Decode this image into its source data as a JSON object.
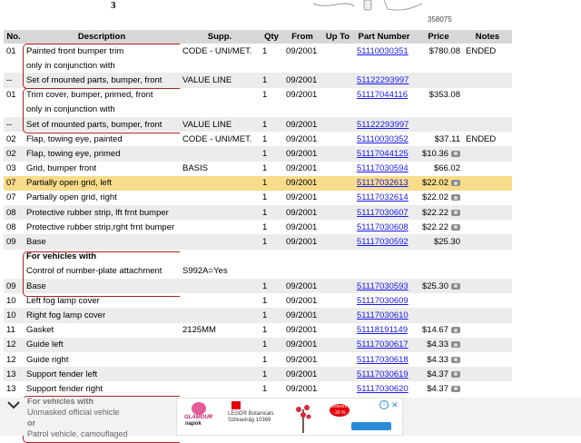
{
  "header": {
    "step_number": "3",
    "diagram_id": "358075"
  },
  "table": {
    "columns": [
      "No.",
      "Description",
      "Supp.",
      "Qty",
      "From",
      "Up To",
      "Part Number",
      "Price",
      "Notes"
    ],
    "rows": [
      {
        "no": "01",
        "desc": "Painted front bumper trim",
        "supp": "CODE - UNI/MET.",
        "qty": "1",
        "from": "09/2001",
        "upto": "",
        "pn": "51110030351",
        "price": "$780.08",
        "notes": "ENDED",
        "style": "",
        "cam": false
      },
      {
        "no": "",
        "desc": "only in conjunction with",
        "supp": "",
        "qty": "",
        "from": "",
        "upto": "",
        "pn": "",
        "price": "",
        "notes": "",
        "style": "",
        "cam": false
      },
      {
        "no": "--",
        "desc": "Set of mounted parts, bumper, front",
        "supp": "VALUE LINE",
        "qty": "1",
        "from": "09/2001",
        "upto": "",
        "pn": "51122293997",
        "price": "",
        "notes": "",
        "style": "alt",
        "cam": false
      },
      {
        "no": "01",
        "desc": "Trim cover, bumper, primed, front",
        "supp": "",
        "qty": "1",
        "from": "09/2001",
        "upto": "",
        "pn": "51117044116",
        "price": "$353.08",
        "notes": "",
        "style": "",
        "cam": false
      },
      {
        "no": "",
        "desc": "only in conjunction with",
        "supp": "",
        "qty": "",
        "from": "",
        "upto": "",
        "pn": "",
        "price": "",
        "notes": "",
        "style": "",
        "cam": false
      },
      {
        "no": "--",
        "desc": "Set of mounted parts, bumper, front",
        "supp": "VALUE LINE",
        "qty": "1",
        "from": "09/2001",
        "upto": "",
        "pn": "51122293997",
        "price": "",
        "notes": "",
        "style": "alt",
        "cam": false
      },
      {
        "no": "02",
        "desc": "Flap, towing eye, painted",
        "supp": "CODE - UNI/MET.",
        "qty": "1",
        "from": "09/2001",
        "upto": "",
        "pn": "51110030352",
        "price": "$37.11",
        "notes": "ENDED",
        "style": "",
        "cam": false
      },
      {
        "no": "02",
        "desc": "Flap, towing eye, primed",
        "supp": "",
        "qty": "1",
        "from": "09/2001",
        "upto": "",
        "pn": "51117044125",
        "price": "$10.36",
        "notes": "",
        "style": "alt",
        "cam": true
      },
      {
        "no": "03",
        "desc": "Grid, bumper front",
        "supp": "BASIS",
        "qty": "1",
        "from": "09/2001",
        "upto": "",
        "pn": "51117030594",
        "price": "$66.02",
        "notes": "",
        "style": "",
        "cam": false
      },
      {
        "no": "07",
        "desc": "Partially open grid, left",
        "supp": "",
        "qty": "1",
        "from": "09/2001",
        "upto": "",
        "pn": "51117032613",
        "price": "$22.02",
        "notes": "",
        "style": "hl",
        "cam": true
      },
      {
        "no": "07",
        "desc": "Partially open grid, right",
        "supp": "",
        "qty": "1",
        "from": "09/2001",
        "upto": "",
        "pn": "51117032614",
        "price": "$22.02",
        "notes": "",
        "style": "",
        "cam": true
      },
      {
        "no": "08",
        "desc": "Protective rubber strip, lft frnt bumper",
        "supp": "",
        "qty": "1",
        "from": "09/2001",
        "upto": "",
        "pn": "51117030607",
        "price": "$22.22",
        "notes": "",
        "style": "alt",
        "cam": true
      },
      {
        "no": "08",
        "desc": "Protective rubber strip,rght frnt bumper",
        "supp": "",
        "qty": "1",
        "from": "09/2001",
        "upto": "",
        "pn": "51117030608",
        "price": "$22.22",
        "notes": "",
        "style": "",
        "cam": true
      },
      {
        "no": "09",
        "desc": "Base",
        "supp": "",
        "qty": "1",
        "from": "09/2001",
        "upto": "",
        "pn": "51117030592",
        "price": "$25.30",
        "notes": "",
        "style": "alt",
        "cam": false
      },
      {
        "no": "",
        "desc": "For vehicles with",
        "supp": "",
        "qty": "",
        "from": "",
        "upto": "",
        "pn": "",
        "price": "",
        "notes": "",
        "style": "",
        "cam": false,
        "bold": true
      },
      {
        "no": "",
        "desc": "Control of number-plate attachment",
        "supp": "S992A=Yes",
        "qty": "",
        "from": "",
        "upto": "",
        "pn": "",
        "price": "",
        "notes": "",
        "style": "",
        "cam": false
      },
      {
        "no": "09",
        "desc": "Base",
        "supp": "",
        "qty": "1",
        "from": "09/2001",
        "upto": "",
        "pn": "51117030593",
        "price": "$25.30",
        "notes": "",
        "style": "alt",
        "cam": true
      },
      {
        "no": "10",
        "desc": "Left fog lamp cover",
        "supp": "",
        "qty": "1",
        "from": "09/2001",
        "upto": "",
        "pn": "51117030609",
        "price": "",
        "notes": "",
        "style": "",
        "cam": false
      },
      {
        "no": "10",
        "desc": "Right fog lamp cover",
        "supp": "",
        "qty": "1",
        "from": "09/2001",
        "upto": "",
        "pn": "51117030610",
        "price": "",
        "notes": "",
        "style": "alt",
        "cam": false
      },
      {
        "no": "11",
        "desc": "Gasket",
        "supp": "2125MM",
        "qty": "1",
        "from": "09/2001",
        "upto": "",
        "pn": "51118191149",
        "price": "$14.67",
        "notes": "",
        "style": "",
        "cam": true
      },
      {
        "no": "12",
        "desc": "Guide left",
        "supp": "",
        "qty": "1",
        "from": "09/2001",
        "upto": "",
        "pn": "51117030617",
        "price": "$4.33",
        "notes": "",
        "style": "alt",
        "cam": true
      },
      {
        "no": "12",
        "desc": "Guide right",
        "supp": "",
        "qty": "1",
        "from": "09/2001",
        "upto": "",
        "pn": "51117030618",
        "price": "$4.33",
        "notes": "",
        "style": "",
        "cam": true
      },
      {
        "no": "13",
        "desc": "Support fender left",
        "supp": "",
        "qty": "1",
        "from": "09/2001",
        "upto": "",
        "pn": "51117030619",
        "price": "$4.37",
        "notes": "",
        "style": "alt",
        "cam": true
      },
      {
        "no": "13",
        "desc": "Support fender right",
        "supp": "",
        "qty": "1",
        "from": "09/2001",
        "upto": "",
        "pn": "51117030620",
        "price": "$4.37",
        "notes": "",
        "style": "",
        "cam": true
      }
    ]
  },
  "footnote": {
    "line1": "For vehicles with",
    "line2": "Unmasked official vehicle",
    "line3": "or",
    "line4": "Patrol vehicle, camouflaged"
  },
  "ad": {
    "brand1": "GLAMOUR",
    "brand1b": "napok",
    "product": "LEGO® Botanicals",
    "product2": "Szilvavirág 10369",
    "badge": "Kedvezmény -20 %",
    "info": "i",
    "close": "✕"
  },
  "colors": {
    "header_bg": "#d7d7d7",
    "row_alt": "#ececec",
    "row_highlight": "#f7dc8a",
    "link": "#1a1aee",
    "bracket": "#b02020"
  }
}
